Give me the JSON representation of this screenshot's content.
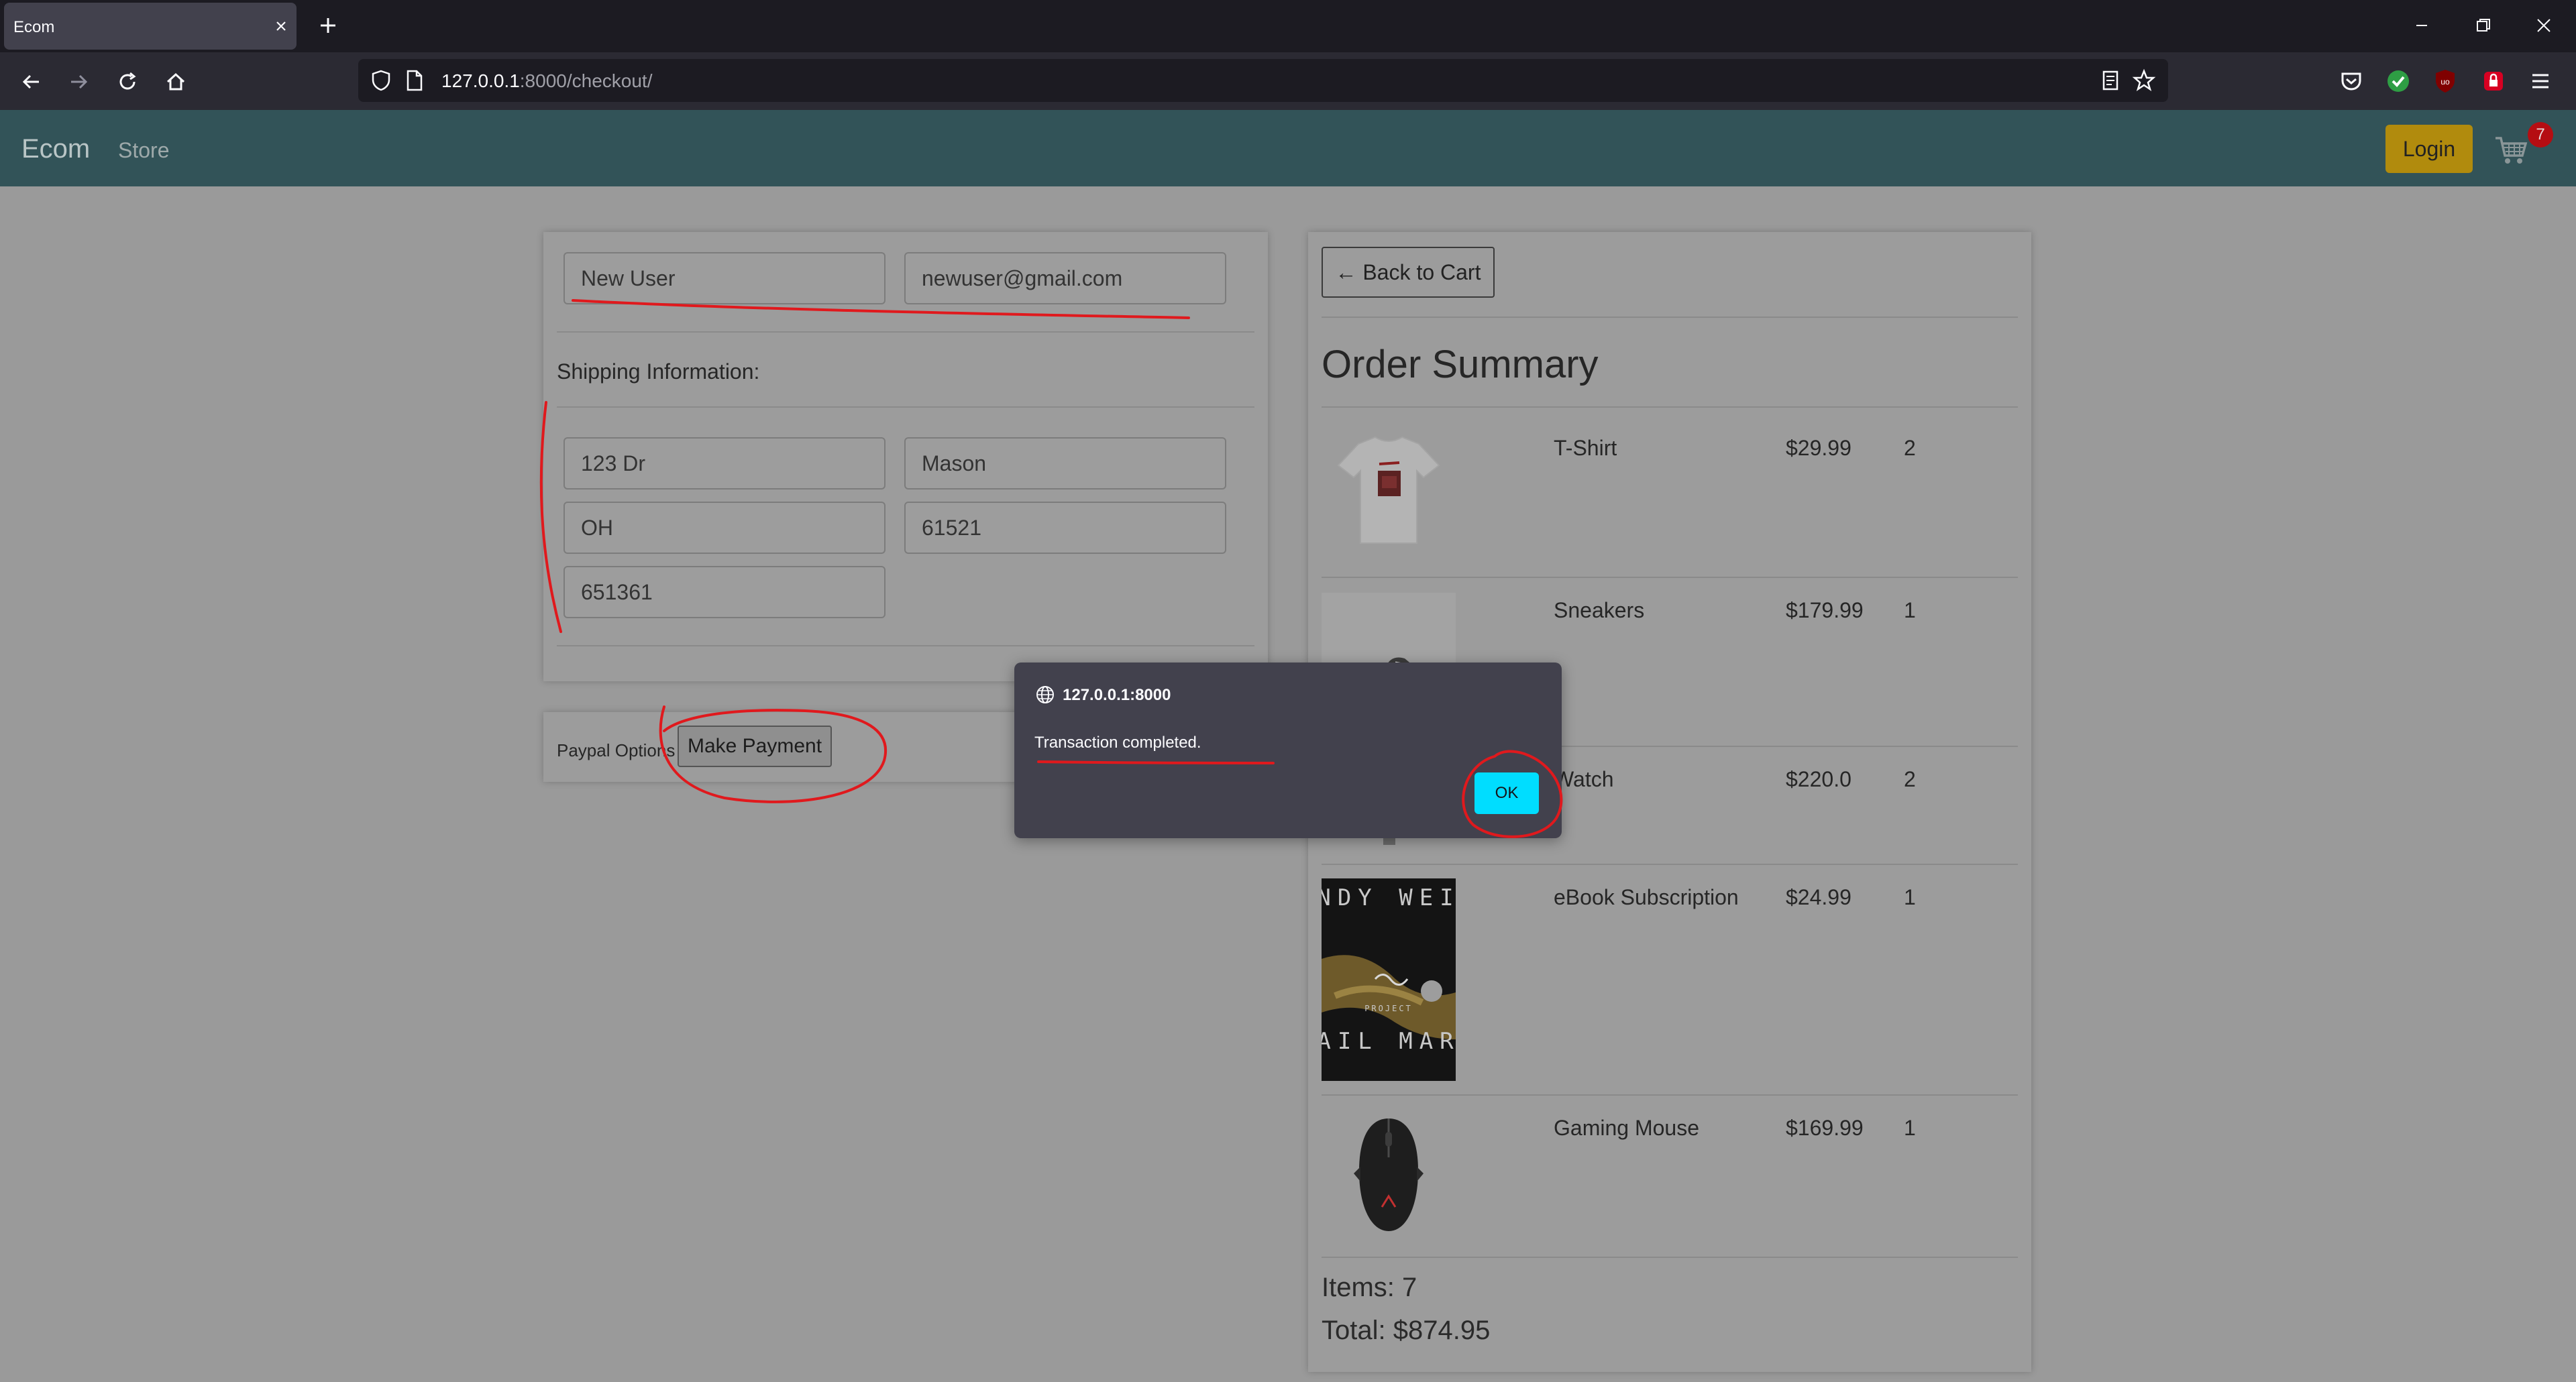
{
  "browser": {
    "tab_title": "Ecom",
    "url_host": "127.0.0.1",
    "url_rest": ":8000/checkout/"
  },
  "site": {
    "brand": "Ecom",
    "store_link": "Store",
    "login_label": "Login",
    "cart_count": "7"
  },
  "form": {
    "name_value": "New User",
    "email_value": "newuser@gmail.com",
    "shipping_heading": "Shipping Information:",
    "address_value": "123 Dr",
    "city_value": "Mason",
    "state_value": "OH",
    "zip_value": "61521",
    "extra_value": "651361"
  },
  "payment": {
    "paypal_label": "Paypal Options",
    "make_payment_label": "Make Payment"
  },
  "summary": {
    "back_label": "← Back to Cart",
    "title": "Order Summary",
    "items": [
      {
        "name": "T-Shirt",
        "price": "$29.99",
        "qty": "2"
      },
      {
        "name": "Sneakers",
        "price": "$179.99",
        "qty": "1"
      },
      {
        "name": "Watch",
        "price": "$220.0",
        "qty": "2"
      },
      {
        "name": "eBook Subscription",
        "price": "$24.99",
        "qty": "1"
      },
      {
        "name": "Gaming Mouse",
        "price": "$169.99",
        "qty": "1"
      }
    ],
    "items_total": "Items: 7",
    "total": "Total: $874.95"
  },
  "book_cover": {
    "top_text": "ANDY WEIR",
    "small_text": "PROJECT",
    "bottom_text": "HAIL MARY"
  },
  "dialog": {
    "origin": "127.0.0.1:8000",
    "message": "Transaction completed.",
    "ok_label": "OK"
  },
  "colors": {
    "site_nav": "#325358",
    "login": "#b18b0d",
    "badge": "#b50d12",
    "dialog_bg": "#42414d",
    "ok_button": "#00ddff",
    "annotation": "#e0191d"
  }
}
